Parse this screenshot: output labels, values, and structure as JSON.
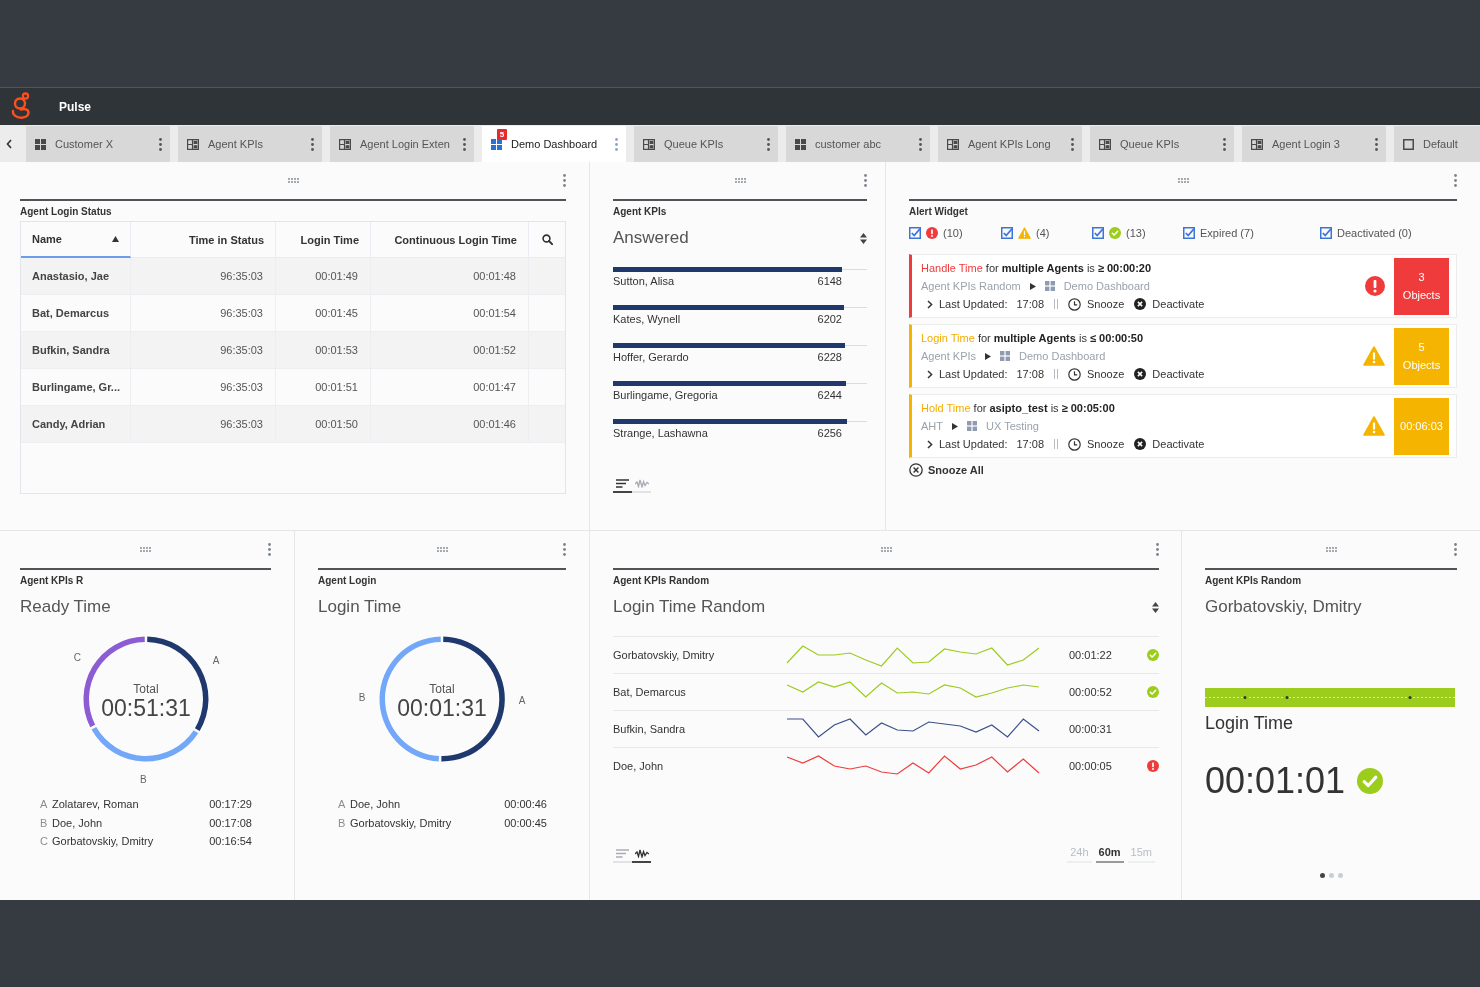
{
  "header": {
    "title": "Pulse"
  },
  "tabs": [
    {
      "label": "Customer X",
      "kind": "grid",
      "selected": false
    },
    {
      "label": "Agent KPIs",
      "kind": "layout",
      "selected": false
    },
    {
      "label": "Agent Login Exten",
      "kind": "layout",
      "selected": false
    },
    {
      "label": "Demo Dashboard",
      "kind": "grid",
      "selected": true,
      "badge": "5"
    },
    {
      "label": "Queue KPIs",
      "kind": "layout",
      "selected": false
    },
    {
      "label": "customer abc",
      "kind": "grid",
      "selected": false
    },
    {
      "label": "Agent KPIs Long",
      "kind": "layout",
      "selected": false
    },
    {
      "label": "Queue KPIs",
      "kind": "layout",
      "selected": false
    },
    {
      "label": "Agent Login 3",
      "kind": "layout",
      "selected": false
    },
    {
      "label": "Default",
      "kind": "blank",
      "selected": false
    }
  ],
  "top_row": [
    {
      "kind": "table",
      "title": "Agent Login Status",
      "columns": [
        {
          "label": "Name",
          "sorted": true
        },
        {
          "label": "Time in Status",
          "sorted": false
        },
        {
          "label": "Login Time",
          "sorted": false
        },
        {
          "label": "Continuous Login Time",
          "sorted": false
        }
      ],
      "rows": [
        [
          "Anastasio, Jae",
          "96:35:03",
          "00:01:49",
          "00:01:48"
        ],
        [
          "Bat, Demarcus",
          "96:35:03",
          "00:01:45",
          "00:01:54"
        ],
        [
          "Bufkin, Sandra",
          "96:35:03",
          "00:01:53",
          "00:01:52"
        ],
        [
          "Burlingame, Gr...",
          "96:35:03",
          "00:01:51",
          "00:01:47"
        ],
        [
          "Candy, Adrian",
          "96:35:03",
          "00:01:50",
          "00:01:46"
        ]
      ]
    },
    {
      "kind": "kpi_list",
      "title": "Agent KPIs",
      "metric": "Answered",
      "rows": [
        {
          "name": "Sutton, Alisa",
          "value": "6148",
          "level": 0.902
        },
        {
          "name": "Kates, Wynell",
          "value": "6202",
          "level": 0.91
        },
        {
          "name": "Hoffer, Gerardo",
          "value": "6228",
          "level": 0.914
        },
        {
          "name": "Burlingame, Gregoria",
          "value": "6244",
          "level": 0.918
        },
        {
          "name": "Strange, Lashawna",
          "value": "6256",
          "level": 0.922
        }
      ],
      "views": [
        {
          "kind": "list",
          "selected": true
        },
        {
          "kind": "trend",
          "selected": false
        }
      ]
    },
    {
      "kind": "alerts",
      "title": "Alert Widget",
      "filters": [
        {
          "kind": "error",
          "label": "(10)",
          "checked": true
        },
        {
          "kind": "warning",
          "label": "(4)",
          "checked": true
        },
        {
          "kind": "ok",
          "label": "(13)",
          "checked": true
        },
        {
          "kind": "plain",
          "label": "Expired (7)",
          "checked": true
        },
        {
          "kind": "plain",
          "label": "Deactivated (0)",
          "checked": true
        }
      ],
      "alerts": [
        {
          "kind": "error",
          "metric": "Handle Time",
          "condition": "for **multiple Agents** is **≥ 00:00:20**",
          "source": "Agent KPIs Random",
          "dashboard": "Demo Dashboard",
          "updated_label": "Last Updated:",
          "updated_time": "17:08",
          "snooze": "Snooze",
          "deactivate": "Deactivate",
          "badge": [
            "3",
            "Objects"
          ]
        },
        {
          "kind": "warning",
          "metric": "Login Time",
          "condition": "for **multiple Agents** is **≤ 00:00:50**",
          "source": "Agent KPIs",
          "dashboard": "Demo Dashboard",
          "updated_label": "Last Updated:",
          "updated_time": "17:08",
          "snooze": "Snooze",
          "deactivate": "Deactivate",
          "badge": [
            "5",
            "Objects"
          ]
        },
        {
          "kind": "warning",
          "metric": "Hold Time",
          "condition": "for **asipto_test** is **≥ 00:05:00**",
          "source": "AHT",
          "dashboard": "UX Testing",
          "updated_label": "Last Updated:",
          "updated_time": "17:08",
          "snooze": "Snooze",
          "deactivate": "Deactivate",
          "badge": [
            "00:06:03"
          ]
        }
      ],
      "snooze_all": "Snooze All"
    }
  ],
  "bottom_row": [
    {
      "kind": "donut",
      "title": "Agent KPIs R",
      "metric": "Ready Time",
      "total_label": "Total",
      "total": "00:51:31",
      "chart_data": {
        "type": "donut",
        "categories": [
          "A",
          "B",
          "C"
        ],
        "values": [
          33.9,
          33.3,
          32.8
        ]
      },
      "legend": [
        {
          "letter": "A",
          "name": "Zolatarev, Roman",
          "value": "00:17:29",
          "color": "#1f386e"
        },
        {
          "letter": "B",
          "name": "Doe, John",
          "value": "00:17:08",
          "color": "#72a8f7"
        },
        {
          "letter": "C",
          "name": "Gorbatovskiy, Dmitry",
          "value": "00:16:54",
          "color": "#8b5cd3"
        }
      ]
    },
    {
      "kind": "donut",
      "title": "Agent Login",
      "metric": "Login Time",
      "total_label": "Total",
      "total": "00:01:31",
      "chart_data": {
        "type": "donut",
        "categories": [
          "A",
          "B"
        ],
        "values": [
          50.5,
          49.5
        ]
      },
      "legend": [
        {
          "letter": "A",
          "name": "Doe, John",
          "value": "00:00:46",
          "color": "#1f386e"
        },
        {
          "letter": "B",
          "name": "Gorbatovskiy, Dmitry",
          "value": "00:00:45",
          "color": "#72a8f7"
        }
      ]
    },
    {
      "kind": "trend",
      "title": "Agent KPIs Random",
      "metric": "Login Time Random",
      "rows": [
        {
          "name": "Gorbatovskiy, Dmitry",
          "value": "00:01:22",
          "kind": "ok"
        },
        {
          "name": "Bat, Demarcus",
          "value": "00:00:52",
          "kind": "ok"
        },
        {
          "name": "Bufkin, Sandra",
          "value": "00:00:31",
          "kind": "neutral"
        },
        {
          "name": "Doe, John",
          "value": "00:00:05",
          "kind": "error"
        }
      ],
      "views": [
        {
          "kind": "list",
          "selected": false
        },
        {
          "kind": "trend",
          "selected": true
        }
      ],
      "ranges": [
        {
          "label": "24h",
          "selected": false
        },
        {
          "label": "60m",
          "selected": true
        },
        {
          "label": "15m",
          "selected": false
        }
      ]
    },
    {
      "kind": "single",
      "title": "Agent KPIs Random",
      "name": "Gorbatovskiy, Dmitry",
      "status": {
        "kind": "ok"
      },
      "metric": "Login Time",
      "value": "00:01:01",
      "pages": [
        {
          "selected": true
        },
        {
          "selected": false
        },
        {
          "selected": false
        }
      ]
    }
  ]
}
